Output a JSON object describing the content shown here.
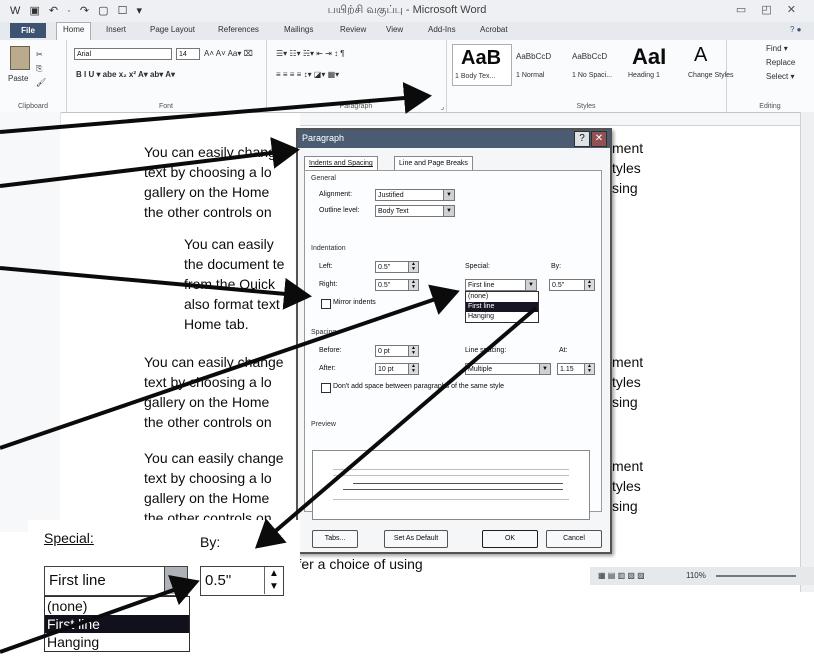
{
  "window": {
    "title": "பயிற்சி வகுப்பு - Microsoft Word",
    "qat_icons": "W ▣ ↶ · ↷ ▢ ☐ ▾",
    "controls": "▭ ◰ ✕"
  },
  "tabs": [
    "File",
    "Home",
    "Insert",
    "Page Layout",
    "References",
    "Mailings",
    "Review",
    "View",
    "Add-Ins",
    "Acrobat"
  ],
  "ribbon": {
    "clipboard": {
      "paste": "Paste",
      "label": "Clipboard"
    },
    "font": {
      "name": "Arial",
      "size": "14",
      "row1_extra": "A˄ A˅ Aa▾ ⌧",
      "row2": "B  I  U ▾  abe  x₂  x²   A▾  ab▾  A▾",
      "label": "Font"
    },
    "paragraph": {
      "row1": "☰▾ ☷▾ ☵▾  ⇤ ⇥  ↕  ¶",
      "row2": "≡ ≡ ≡ ≡  ↕▾  ◪▾ ▦▾",
      "label": "Paragraph"
    },
    "styles": {
      "items": [
        {
          "preview": "AaB",
          "name": "1 Body Tex..."
        },
        {
          "preview": "AaBbCcD",
          "name": "1 Normal"
        },
        {
          "preview": "AaBbCcD",
          "name": "1 No Spaci..."
        },
        {
          "preview": "AaI",
          "name": "Heading 1"
        }
      ],
      "change_styles": "Change Styles",
      "label": "Styles"
    },
    "editing": {
      "find": "Find ▾",
      "replace": "Replace",
      "select": "Select ▾",
      "label": "Editing"
    }
  },
  "document": {
    "para1": [
      "You can easily change",
      "text by choosing a lo",
      "gallery on the Home",
      "the other controls on"
    ],
    "para1_right": [
      "ment",
      "tyles",
      "sing"
    ],
    "para2": [
      "You can easily",
      "the document te",
      "from the Quick",
      "also format text",
      "Home tab."
    ],
    "para3": [
      "You can easily change",
      "text by choosing a lo",
      "gallery on the Home",
      "the other controls on"
    ],
    "para3_right": [
      "ment",
      "tyles",
      "sing"
    ],
    "para4": [
      "You can easily change",
      "text by choosing a lo",
      "gallery on the Home",
      "the other controls on"
    ],
    "para4_right": [
      "ment",
      "tyles",
      "sing"
    ],
    "tail": "offer a choice of using"
  },
  "dialog": {
    "title": "Paragraph",
    "help": "?",
    "close": "✕",
    "tabs": [
      "Indents and Spacing",
      "Line and Page Breaks"
    ],
    "general": "General",
    "alignment_label": "Alignment:",
    "alignment_value": "Justified",
    "outline_label": "Outline level:",
    "outline_value": "Body Text",
    "indentation": "Indentation",
    "left_label": "Left:",
    "left_value": "0.5\"",
    "right_label": "Right:",
    "right_value": "0.5\"",
    "special_label": "Special:",
    "special_value": "First line",
    "by_label": "By:",
    "by_value": "0.5\"",
    "special_options": [
      "(none)",
      "First line",
      "Hanging"
    ],
    "mirror_label": "Mirror indents",
    "spacing": "Spacing",
    "before_label": "Before:",
    "before_value": "0 pt",
    "after_label": "After:",
    "after_value": "10 pt",
    "line_spacing_label": "Line spacing:",
    "line_spacing_value": "Multiple",
    "at_label": "At:",
    "at_value": "1.15",
    "dont_add_label": "Don't add space between paragraphs of the same style",
    "preview": "Preview",
    "buttons": {
      "tabs": "Tabs...",
      "default": "Set As Default",
      "ok": "OK",
      "cancel": "Cancel"
    }
  },
  "inset": {
    "special_label": "Special:",
    "by_label": "By:",
    "special_value": "First line",
    "by_value": "0.5\"",
    "options": [
      "(none)",
      "First line",
      "Hanging"
    ]
  },
  "status": {
    "zoom": "110%"
  }
}
